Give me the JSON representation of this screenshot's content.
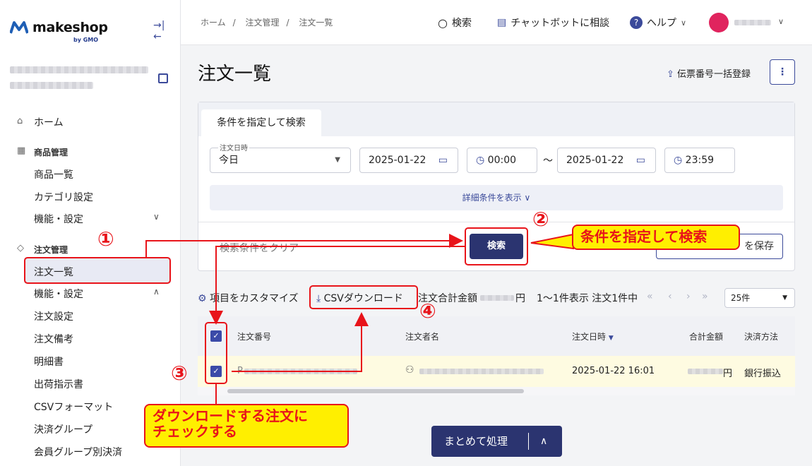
{
  "brand": {
    "name": "makeshop",
    "sub": "by GMO"
  },
  "sidebar": {
    "home": "ホーム",
    "products_head": "商品管理",
    "products_items": [
      "商品一覧",
      "カテゴリ設定",
      "機能・設定"
    ],
    "orders_head": "注文管理",
    "orders_items": [
      "注文一覧",
      "機能・設定",
      "注文設定",
      "注文備考",
      "明細書",
      "出荷指示書",
      "CSVフォーマット",
      "決済グループ",
      "会員グループ別決済"
    ]
  },
  "topbar": {
    "breadcrumb": [
      "ホーム",
      "注文管理",
      "注文一覧"
    ],
    "search": "検索",
    "chatbot": "チャットボットに相談",
    "help": "ヘルプ"
  },
  "page": {
    "title": "注文一覧",
    "bulk_register": "伝票番号一括登録"
  },
  "search_panel": {
    "tab": "条件を指定して検索",
    "date_label": "注文日時",
    "date_preset": "今日",
    "date_from": "2025-01-22",
    "time_from": "00:00",
    "tilde": "〜",
    "date_to": "2025-01-22",
    "time_to": "23:59",
    "detail": "詳細条件を表示",
    "clear": "検索条件をクリア",
    "search_button": "検索",
    "save_button": "を保存"
  },
  "toolbar": {
    "customize": "項目をカスタマイズ",
    "csv": "CSVダウンロード",
    "total_label": "注文合計金額",
    "yen": "円",
    "count": "1〜1件表示 注文1件中",
    "per_page": "25件"
  },
  "table": {
    "headers": [
      "注文番号",
      "注文者名",
      "注文日時",
      "合計金額",
      "決済方法"
    ],
    "row": {
      "order_prefix": "P",
      "date": "2025-01-22 16:01",
      "yen": "円",
      "payment": "銀行振込"
    }
  },
  "bulk_action": {
    "label": "まとめて処理"
  },
  "annotations": {
    "n1": "①",
    "n2": "②",
    "n3": "③",
    "n4": "④",
    "callout_search": "条件を指定して検索",
    "callout_check_1": "ダウンロードする注文に",
    "callout_check_2": "チェックする"
  },
  "colors": {
    "primary": "#2b3470",
    "annotation_red": "#e8141a",
    "callout_yellow": "#ffef00",
    "row_highlight": "#fefbe1"
  }
}
